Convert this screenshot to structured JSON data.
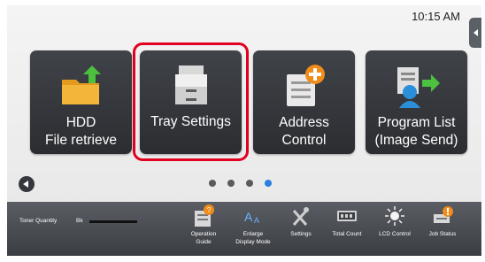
{
  "status": {
    "time": "10:15 AM"
  },
  "tiles": [
    {
      "line1": "HDD",
      "line2": "File retrieve",
      "icon": "folder-upload-icon",
      "selected": false
    },
    {
      "line1": "Tray Settings",
      "line2": "",
      "icon": "printer-tray-icon",
      "selected": true
    },
    {
      "line1": "Address",
      "line2": "Control",
      "icon": "address-book-add-icon",
      "selected": false
    },
    {
      "line1": "Program List",
      "line2": "(Image Send)",
      "icon": "program-list-send-icon",
      "selected": false
    }
  ],
  "pager": {
    "count": 4,
    "active_index": 3
  },
  "bottom": {
    "toner_label": "Toner Quantity",
    "toner_color": "Bk",
    "tools": [
      {
        "line1": "Operation",
        "line2": "Guide",
        "icon": "help-guide-icon"
      },
      {
        "line1": "Enlarge",
        "line2": "Display Mode",
        "icon": "enlarge-text-icon"
      },
      {
        "line1": "Settings",
        "line2": "",
        "icon": "tools-icon"
      },
      {
        "line1": "Total Count",
        "line2": "",
        "icon": "counter-icon"
      },
      {
        "line1": "LCD Control",
        "line2": "",
        "icon": "brightness-icon"
      },
      {
        "line1": "Job Status",
        "line2": "",
        "icon": "job-status-icon"
      }
    ]
  },
  "colors": {
    "highlight": "#e1001f",
    "active_dot": "#2a7fe0",
    "tile": "#35383d"
  }
}
